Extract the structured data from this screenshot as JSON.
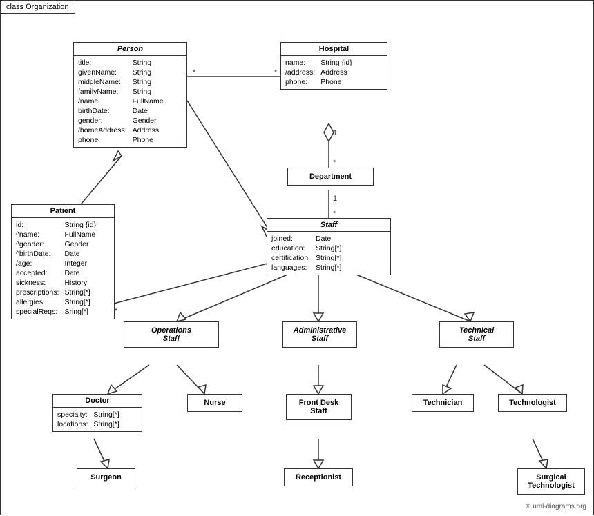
{
  "diagram": {
    "title": "class Organization",
    "copyright": "© uml-diagrams.org",
    "boxes": {
      "person": {
        "title": "Person",
        "fields": [
          [
            "title:",
            "String"
          ],
          [
            "givenName:",
            "String"
          ],
          [
            "middleName:",
            "String"
          ],
          [
            "familyName:",
            "String"
          ],
          [
            "/name:",
            "FullName"
          ],
          [
            "birthDate:",
            "Date"
          ],
          [
            "gender:",
            "Gender"
          ],
          [
            "/homeAddress:",
            "Address"
          ],
          [
            "phone:",
            "Phone"
          ]
        ]
      },
      "hospital": {
        "title": "Hospital",
        "fields": [
          [
            "name:",
            "String {id}"
          ],
          [
            "/address:",
            "Address"
          ],
          [
            "phone:",
            "Phone"
          ]
        ]
      },
      "patient": {
        "title": "Patient",
        "fields": [
          [
            "id:",
            "String {id}"
          ],
          [
            "^name:",
            "FullName"
          ],
          [
            "^gender:",
            "Gender"
          ],
          [
            "^birthDate:",
            "Date"
          ],
          [
            "/age:",
            "Integer"
          ],
          [
            "accepted:",
            "Date"
          ],
          [
            "sickness:",
            "History"
          ],
          [
            "prescriptions:",
            "String[*]"
          ],
          [
            "allergies:",
            "String[*]"
          ],
          [
            "specialReqs:",
            "Sring[*]"
          ]
        ]
      },
      "department": {
        "title": "Department"
      },
      "staff": {
        "title": "Staff",
        "fields": [
          [
            "joined:",
            "Date"
          ],
          [
            "education:",
            "String[*]"
          ],
          [
            "certification:",
            "String[*]"
          ],
          [
            "languages:",
            "String[*]"
          ]
        ]
      },
      "operations_staff": {
        "title": "Operations\nStaff"
      },
      "administrative_staff": {
        "title": "Administrative\nStaff"
      },
      "technical_staff": {
        "title": "Technical\nStaff"
      },
      "doctor": {
        "title": "Doctor",
        "fields": [
          [
            "specialty:",
            "String[*]"
          ],
          [
            "locations:",
            "String[*]"
          ]
        ]
      },
      "nurse": {
        "title": "Nurse"
      },
      "front_desk_staff": {
        "title": "Front Desk\nStaff"
      },
      "technician": {
        "title": "Technician"
      },
      "technologist": {
        "title": "Technologist"
      },
      "surgeon": {
        "title": "Surgeon"
      },
      "receptionist": {
        "title": "Receptionist"
      },
      "surgical_technologist": {
        "title": "Surgical\nTechnologist"
      }
    }
  }
}
